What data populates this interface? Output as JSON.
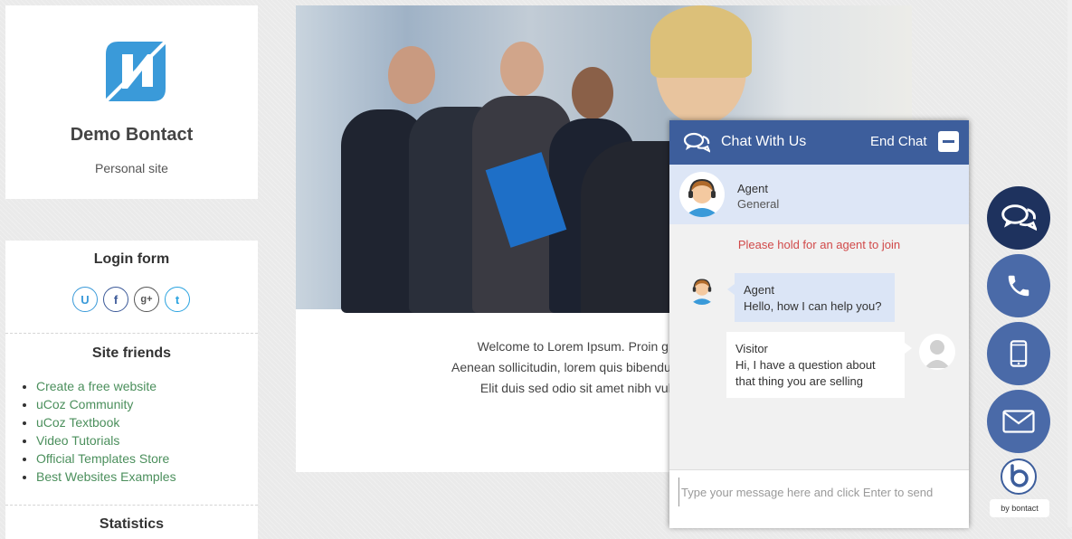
{
  "profile": {
    "logo_icon": "ucoz-logo-icon",
    "site_title": "Demo Bontact",
    "site_subtitle": "Personal site"
  },
  "sidebar": {
    "login_title": "Login form",
    "social_icons": [
      {
        "name": "ucoz-login-icon",
        "glyph": "U",
        "color": "#3a9ad9"
      },
      {
        "name": "facebook-icon",
        "glyph": "f",
        "color": "#3b5998"
      },
      {
        "name": "google-plus-icon",
        "glyph": "g+",
        "color": "#555555"
      },
      {
        "name": "twitter-icon",
        "glyph": "t",
        "color": "#2aa3e0"
      }
    ],
    "friends_title": "Site friends",
    "friends": [
      "Create a free website",
      "uCoz Community",
      "uCoz Textbook",
      "Video Tutorials",
      "Official Templates Store",
      "Best Websites Examples"
    ],
    "stats_title": "Statistics"
  },
  "content": {
    "welcome_lines": [
      "Welcome to Lorem Ipsum. Proin gravida nibh",
      "Aenean sollicitudin, lorem quis bibendum auctor, nisi e",
      "Elit duis sed odio sit amet nibh vulputate cur"
    ]
  },
  "chat": {
    "title": "Chat With Us",
    "end_label": "End Chat",
    "agent_name": "Agent",
    "agent_department": "General",
    "hold_message": "Please hold for an agent to join",
    "messages": [
      {
        "sender": "Agent",
        "text": "Hello, how I can help you?"
      },
      {
        "sender": "Visitor",
        "text": "Hi, I have a question about that thing you are selling"
      }
    ],
    "input_placeholder": "Type your message here and click Enter to send"
  },
  "floating_buttons": [
    {
      "name": "chat-fab",
      "icon": "chat-bubbles-icon"
    },
    {
      "name": "phone-fab",
      "icon": "phone-icon"
    },
    {
      "name": "mobile-fab",
      "icon": "mobile-icon"
    },
    {
      "name": "email-fab",
      "icon": "envelope-icon"
    }
  ],
  "branding": {
    "text": "by bontact"
  },
  "colors": {
    "chat_header": "#3d5e9c",
    "fab_active": "#1e325e",
    "fab": "#4a6aa8",
    "link": "#4b8f5c",
    "hold_message": "#d14a4a"
  }
}
